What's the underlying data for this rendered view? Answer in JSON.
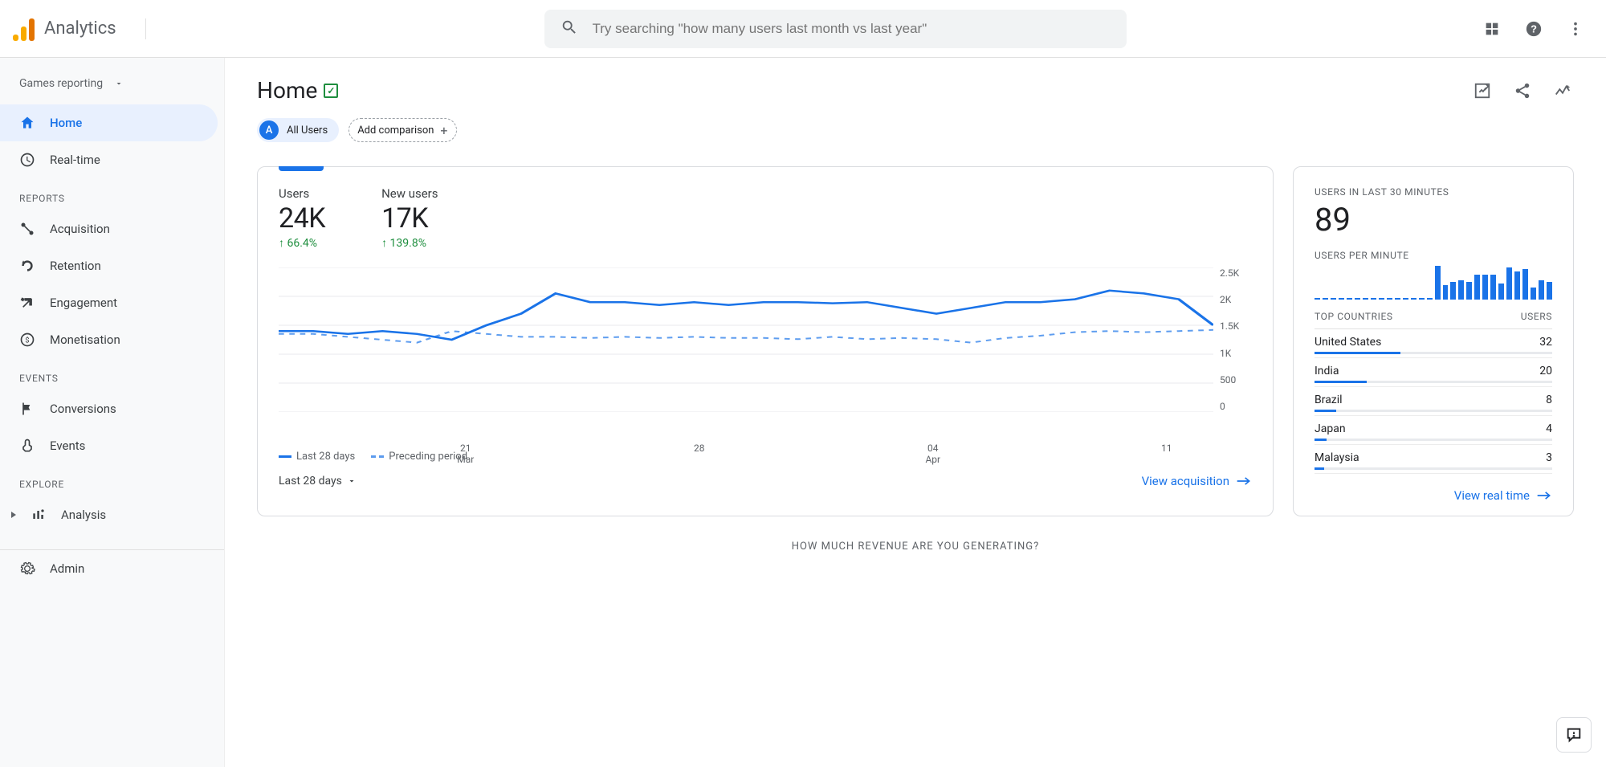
{
  "brand": "Analytics",
  "search": {
    "placeholder": "Try searching \"how many users last month vs last year\""
  },
  "property_selector": "Games reporting",
  "sidebar": {
    "primary": [
      {
        "label": "Home",
        "icon": "home",
        "active": true
      },
      {
        "label": "Real-time",
        "icon": "clock",
        "active": false
      }
    ],
    "section_reports": "REPORTS",
    "reports": [
      {
        "label": "Acquisition",
        "icon": "acquisition"
      },
      {
        "label": "Retention",
        "icon": "retention"
      },
      {
        "label": "Engagement",
        "icon": "engagement"
      },
      {
        "label": "Monetisation",
        "icon": "monetisation"
      }
    ],
    "section_events": "EVENTS",
    "events": [
      {
        "label": "Conversions",
        "icon": "flag"
      },
      {
        "label": "Events",
        "icon": "touch"
      }
    ],
    "section_explore": "EXPLORE",
    "explore_label": "Analysis",
    "admin_label": "Admin"
  },
  "page": {
    "title": "Home"
  },
  "filters": {
    "all_users": "All Users",
    "add_comparison": "Add comparison"
  },
  "metrics": {
    "users": {
      "label": "Users",
      "value": "24K",
      "delta": "66.4%"
    },
    "new_users": {
      "label": "New users",
      "value": "17K",
      "delta": "139.8%"
    }
  },
  "range_selector": "Last 28 days",
  "view_acquisition": "View acquisition",
  "chart_data": {
    "type": "line",
    "title": "",
    "xlabel": "",
    "ylabel": "",
    "ylim": [
      0,
      2500
    ],
    "y_ticks": [
      "2.5K",
      "2K",
      "1.5K",
      "1K",
      "500",
      "0"
    ],
    "x_ticks": [
      {
        "major": "21",
        "minor": "Mar",
        "pos": 0.2
      },
      {
        "major": "28",
        "minor": "",
        "pos": 0.45
      },
      {
        "major": "04",
        "minor": "Apr",
        "pos": 0.7
      },
      {
        "major": "11",
        "minor": "",
        "pos": 0.95
      }
    ],
    "legend": [
      {
        "name": "Last 28 days",
        "style": "solid"
      },
      {
        "name": "Preceding period",
        "style": "dashed"
      }
    ],
    "series": [
      {
        "name": "Last 28 days",
        "style": "solid",
        "values": [
          1400,
          1400,
          1350,
          1400,
          1350,
          1250,
          1500,
          1700,
          2050,
          1900,
          1900,
          1850,
          1900,
          1850,
          1900,
          1900,
          1880,
          1900,
          1800,
          1700,
          1800,
          1900,
          1900,
          1950,
          2100,
          2050,
          1950,
          1500
        ]
      },
      {
        "name": "Preceding period",
        "style": "dashed",
        "values": [
          1350,
          1350,
          1300,
          1250,
          1200,
          1400,
          1350,
          1300,
          1300,
          1280,
          1300,
          1280,
          1300,
          1280,
          1280,
          1260,
          1300,
          1260,
          1280,
          1260,
          1200,
          1280,
          1320,
          1380,
          1400,
          1380,
          1400,
          1420
        ]
      }
    ]
  },
  "realtime": {
    "label_30min": "USERS IN LAST 30 MINUTES",
    "value": "89",
    "label_per_min": "USERS PER MINUTE",
    "minibars": [
      1,
      1,
      1,
      1,
      1,
      1,
      1,
      1,
      1,
      1,
      1,
      1,
      1,
      1,
      1,
      38,
      16,
      20,
      22,
      20,
      28,
      28,
      28,
      18,
      36,
      32,
      34,
      14,
      22,
      20
    ],
    "top_countries_label": "TOP COUNTRIES",
    "users_label": "USERS",
    "countries": [
      {
        "name": "United States",
        "users": 32,
        "pct": 36
      },
      {
        "name": "India",
        "users": 20,
        "pct": 22
      },
      {
        "name": "Brazil",
        "users": 8,
        "pct": 9
      },
      {
        "name": "Japan",
        "users": 4,
        "pct": 5
      },
      {
        "name": "Malaysia",
        "users": 3,
        "pct": 4
      }
    ],
    "view_realtime": "View real time"
  },
  "revenue_banner": "HOW MUCH REVENUE ARE YOU GENERATING?"
}
